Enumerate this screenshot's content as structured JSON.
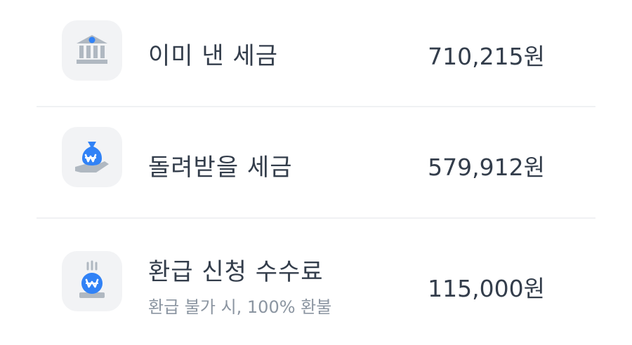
{
  "items": [
    {
      "icon": "bank-icon",
      "title": "이미 낸 세금",
      "amount": "710,215원"
    },
    {
      "icon": "money-bag-hand-icon",
      "title": "돌려받을 세금",
      "amount": "579,912원"
    },
    {
      "icon": "hot-coin-icon",
      "title": "환급 신청 수수료",
      "subtitle": "환급 불가 시, 100% 환불",
      "amount": "115,000원"
    }
  ],
  "colors": {
    "icon_blue": "#3182f6",
    "icon_gray": "#b0b8c1",
    "text_primary": "#333d4b",
    "text_secondary": "#8b95a1",
    "icon_background": "#f2f3f5"
  }
}
